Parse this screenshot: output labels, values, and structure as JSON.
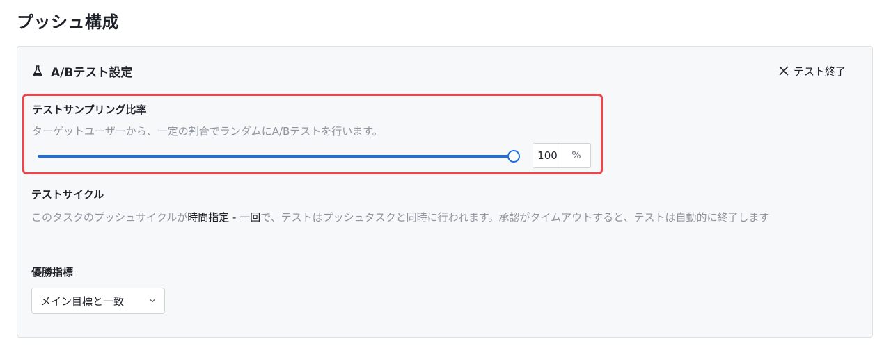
{
  "page": {
    "title": "プッシュ構成"
  },
  "panel": {
    "title": "A/Bテスト設定",
    "end_test_label": "テスト終了",
    "icons": {
      "header": "flask-icon",
      "end": "close-icon"
    }
  },
  "sampling": {
    "label": "テストサンプリング比率",
    "description": "ターゲットユーザーから、一定の割合でランダムにA/Bテストを行います。",
    "value": "100",
    "unit": "%",
    "slider_fraction": 1.0,
    "accent_color": "#1e6fe0",
    "highlight_color": "#e5484d"
  },
  "cycle": {
    "label": "テストサイクル",
    "desc_before": "このタスクのプッシュサイクルが",
    "desc_emphasis": "時間指定 - 一回",
    "desc_after": "で、テストはプッシュタスクと同時に行われます。承認がタイムアウトすると、テストは自動的に終了します"
  },
  "winner": {
    "label": "優勝指標",
    "selected": "メイン目標と一致",
    "icon": "chevron-down-icon"
  }
}
